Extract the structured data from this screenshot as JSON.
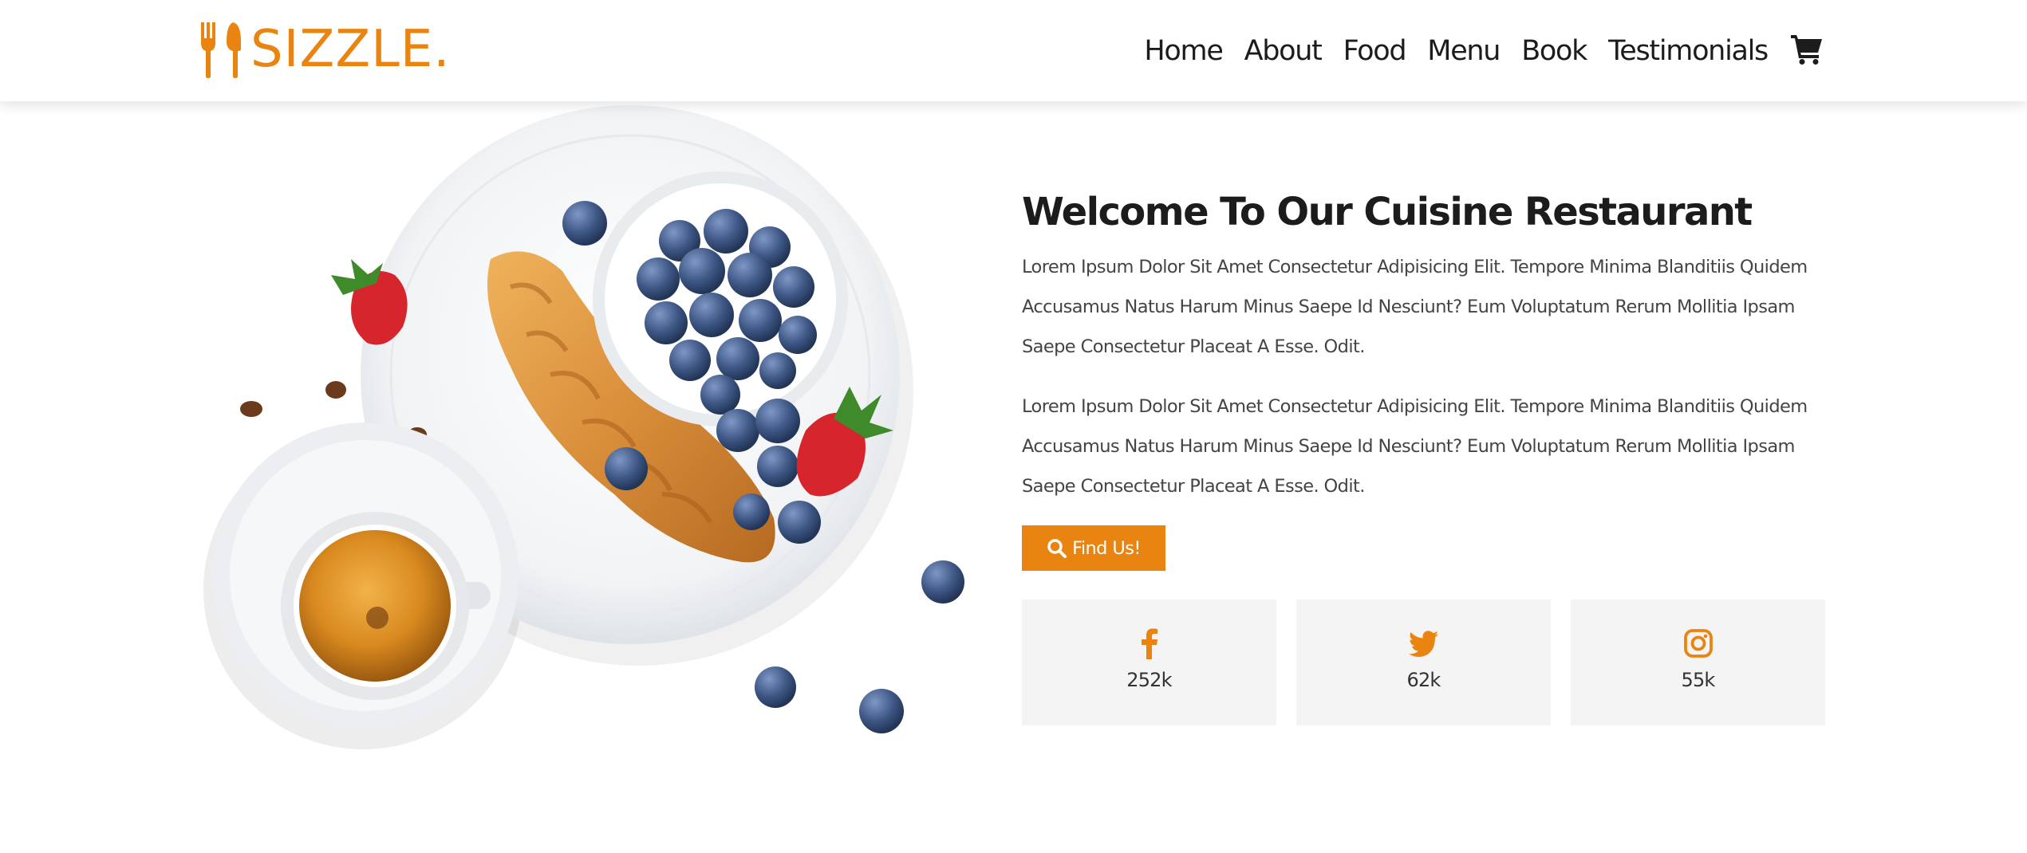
{
  "brand": {
    "name": "SIZZLE.",
    "accent_color": "#ea8410",
    "logo_icon": "fork-knife-icon"
  },
  "nav": {
    "items": [
      {
        "label": "Home"
      },
      {
        "label": "About"
      },
      {
        "label": "Food"
      },
      {
        "label": "Menu"
      },
      {
        "label": "Book"
      },
      {
        "label": "Testimonials"
      }
    ],
    "cart_icon": "shopping-cart-icon"
  },
  "hero": {
    "image": "breakfast plate with croissant, blueberries, strawberries and espresso cup",
    "title": "Welcome To Our Cuisine Restaurant",
    "paragraphs": [
      "Lorem Ipsum Dolor Sit Amet Consectetur Adipisicing Elit. Tempore Minima Blanditiis Quidem Accusamus Natus Harum Minus Saepe Id Nesciunt? Eum Voluptatum Rerum Mollitia Ipsam Saepe Consectetur Placeat A Esse. Odit.",
      "Lorem Ipsum Dolor Sit Amet Consectetur Adipisicing Elit. Tempore Minima Blanditiis Quidem Accusamus Natus Harum Minus Saepe Id Nesciunt? Eum Voluptatum Rerum Mollitia Ipsam Saepe Consectetur Placeat A Esse. Odit."
    ],
    "button": {
      "label": "Find Us!",
      "icon": "search-icon"
    }
  },
  "socials": [
    {
      "icon": "facebook-icon",
      "count": "252k"
    },
    {
      "icon": "twitter-icon",
      "count": "62k"
    },
    {
      "icon": "instagram-icon",
      "count": "55k"
    }
  ]
}
